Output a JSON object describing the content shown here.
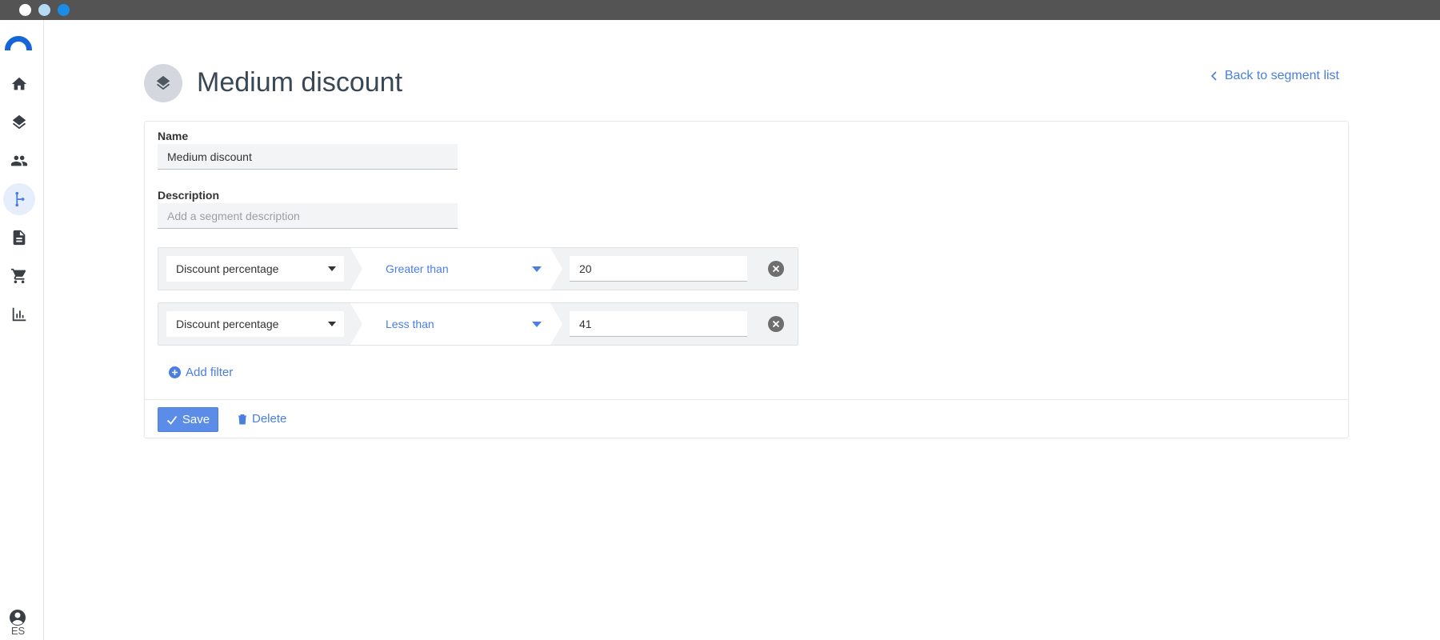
{
  "sidebar": {
    "items": [
      {
        "name": "home-icon",
        "active": false
      },
      {
        "name": "layers-icon",
        "active": false
      },
      {
        "name": "people-icon",
        "active": false
      },
      {
        "name": "segments-icon",
        "active": true
      },
      {
        "name": "document-icon",
        "active": false
      },
      {
        "name": "cart-icon",
        "active": false
      },
      {
        "name": "bar-chart-icon",
        "active": false
      }
    ],
    "language": "ES"
  },
  "header": {
    "title": "Medium discount",
    "back_label": "Back to segment list"
  },
  "form": {
    "name_label": "Name",
    "name_value": "Medium discount",
    "description_label": "Description",
    "description_placeholder": "Add a segment description",
    "description_value": ""
  },
  "filters": [
    {
      "property": "Discount percentage",
      "operator": "Greater than",
      "value": "20"
    },
    {
      "property": "Discount percentage",
      "operator": "Less than",
      "value": "41"
    }
  ],
  "actions": {
    "add_filter_label": "Add filter",
    "save_label": "Save",
    "delete_label": "Delete"
  },
  "colors": {
    "accent": "#4a7ee0",
    "primary_button": "#5b8de8",
    "logo": "#1565d8",
    "titlebar": "#545454"
  }
}
